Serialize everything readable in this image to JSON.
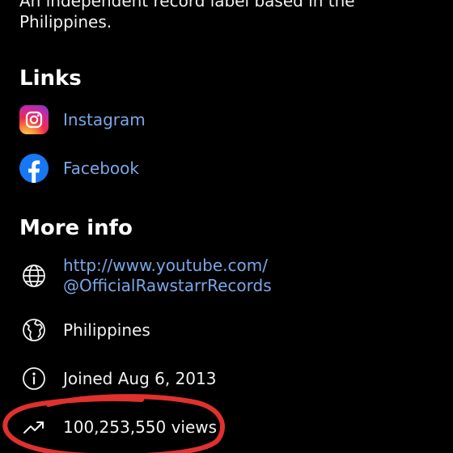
{
  "about": {
    "description": "An independent record label based in the Philippines."
  },
  "links": {
    "heading": "Links",
    "items": [
      {
        "label": "Instagram",
        "icon": "instagram-icon"
      },
      {
        "label": "Facebook",
        "icon": "facebook-icon"
      }
    ]
  },
  "more_info": {
    "heading": "More info",
    "website_line1": "http://www.youtube.com/",
    "website_line2": "@OfficialRawstarrRecords",
    "country": "Philippines",
    "joined": "Joined Aug 6, 2013",
    "views": "100,253,550 views"
  },
  "icons": {
    "website": "globe-icon",
    "country": "globe-africa-icon",
    "joined": "info-icon",
    "views": "trending-up-icon"
  },
  "colors": {
    "background": "#000000",
    "text": "#f1f1f1",
    "link": "#7aa7e6",
    "annotation": "#e0312e",
    "facebook": "#1877f2"
  }
}
